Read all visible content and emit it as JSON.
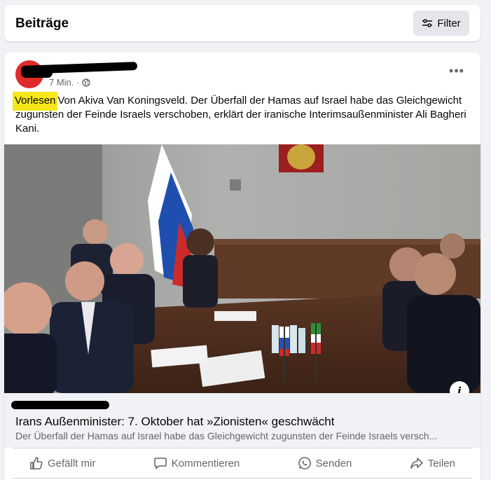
{
  "header": {
    "title": "Beiträge",
    "filter_label": "Filter"
  },
  "post": {
    "time": "7 Min. ·",
    "more": "•••",
    "read_aloud": "Vorlesen",
    "text": "Von Akiva Van Koningsveld. Der Überfall der Hamas auf Israel habe das Gleichgewicht zugunsten der Feinde Israels verschoben, erklärt der iranische Interimsaußenminister Ali Bagheri Kani."
  },
  "link_preview": {
    "title": "Irans Außenminister: 7. Oktober hat »Zionisten« geschwächt",
    "description": "Der Überfall der Hamas auf Israel habe das Gleichgewicht zugunsten der Feinde Israels versch..."
  },
  "actions": [
    {
      "label": "Gefällt mir",
      "icon": "like-icon"
    },
    {
      "label": "Kommentieren",
      "icon": "comment-icon"
    },
    {
      "label": "Senden",
      "icon": "messenger-icon"
    },
    {
      "label": "Teilen",
      "icon": "share-icon"
    }
  ],
  "info_label": "i"
}
